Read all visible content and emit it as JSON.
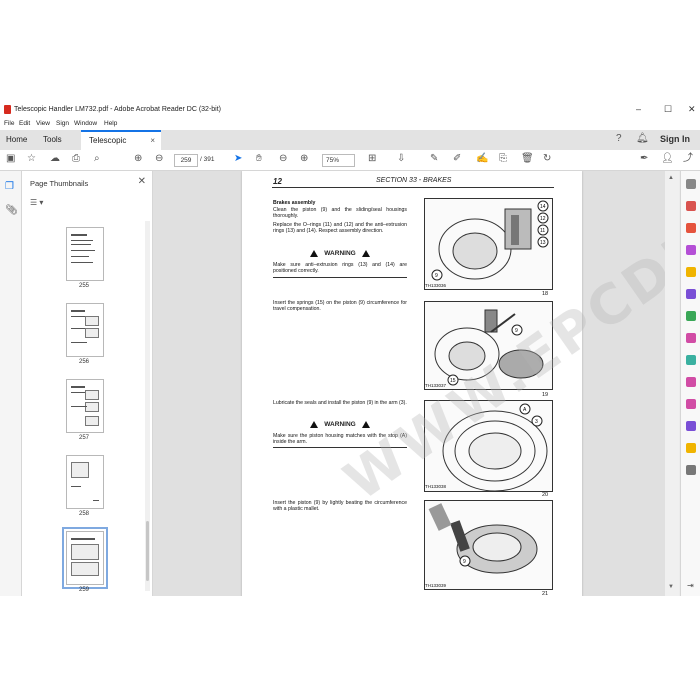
{
  "window": {
    "title": "Telescopic Handler LM732.pdf - Adobe Acrobat Reader DC (32-bit)",
    "controls": [
      "–",
      "☐",
      "✕"
    ]
  },
  "menubar": [
    "File",
    "Edit",
    "View",
    "Sign",
    "Window",
    "Help"
  ],
  "tabs": {
    "home": "Home",
    "tools": "Tools",
    "doc": "Telescopic Handler ...",
    "close": "×"
  },
  "signin": "Sign In",
  "toolbar": {
    "page_current": "259",
    "page_total": "/ 391",
    "zoom": "75%"
  },
  "panel": {
    "title": "Page Thumbnails",
    "close": "✕",
    "thumbnails": [
      "255",
      "256",
      "257",
      "258",
      "259"
    ],
    "selected": "259"
  },
  "document": {
    "page_number": "12",
    "section": "SECTION 33 - BRAKES",
    "blocks": {
      "brakes_heading": "Brakes assembly",
      "p1": "Clean the piston (9) and the sliding/seal housings thoroughly.",
      "p2": "Replace the O–rings (11) and (12) and the anti–extrusion rings (13) and (14). Respect assembly direction.",
      "warning_label": "WARNING",
      "warn1": "Make sure anti–extrusion rings (13) and (14) are positioned correctly.",
      "p3": "Insert the springs (15) on the piston (9) circumference for travel compensation.",
      "p4": "Lubricate the seals and install the piston (9) in the arm (3).",
      "warn2": "Make sure the piston housing matches with the stop (A) inside the arm.",
      "p5": "Insert the piston (9) by lightly beating the circumference with a plastic mallet."
    },
    "figures": [
      {
        "tag": "TH133036",
        "number": "18",
        "labels": [
          "14",
          "12",
          "11",
          "13",
          "9"
        ]
      },
      {
        "tag": "TH133037",
        "number": "19",
        "labels": [
          "9",
          "15"
        ]
      },
      {
        "tag": "TH133038",
        "number": "20",
        "labels": [
          "A",
          "3"
        ]
      },
      {
        "tag": "TH133039",
        "number": "21",
        "labels": [
          "9"
        ]
      }
    ]
  },
  "watermark": "WWW.EPCDEPOT.COM",
  "colors": {
    "accent": "#1473e6",
    "pdf_red": "#d62a1e"
  }
}
